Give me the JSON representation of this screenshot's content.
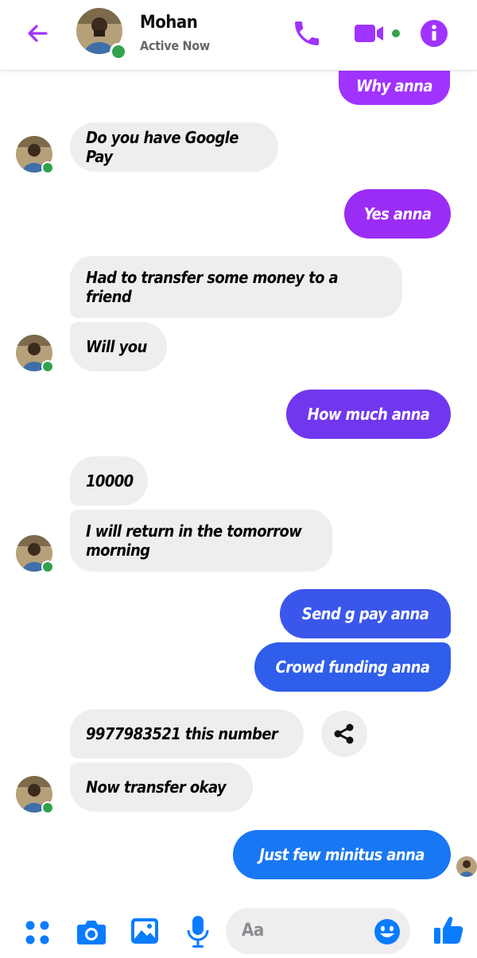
{
  "header": {
    "name": "Mohan",
    "status": "Active Now",
    "accent_color": "#a033ff"
  },
  "messages": [
    {
      "from": "me",
      "text": "Why anna",
      "color": "#a033ff"
    },
    {
      "from": "them",
      "text": "Do you have Google Pay"
    },
    {
      "from": "me",
      "text": "Yes anna",
      "color": "#9b2cf5"
    },
    {
      "from": "them",
      "text": "Had to transfer some money to a friend"
    },
    {
      "from": "them",
      "text": "Will you"
    },
    {
      "from": "me",
      "text": "How much anna",
      "color": "#7137ee"
    },
    {
      "from": "them",
      "text": "10000"
    },
    {
      "from": "them",
      "text": "I will return in the tomorrow morning"
    },
    {
      "from": "me",
      "text": "Send g pay anna",
      "color": "#3b56ea"
    },
    {
      "from": "me",
      "text": "Crowd funding anna",
      "color": "#2e5eea"
    },
    {
      "from": "them",
      "text": "9977983521 this number"
    },
    {
      "from": "them",
      "text": "Now transfer okay"
    },
    {
      "from": "me",
      "text": "Just few minitus anna",
      "color": "#1877f2"
    }
  ],
  "composer": {
    "placeholder": "Aa",
    "icon_color": "#0a7cff"
  },
  "icons": [
    "back-arrow-icon",
    "phone-icon",
    "video-icon",
    "info-icon",
    "share-icon",
    "menu-dots-icon",
    "camera-icon",
    "image-icon",
    "microphone-icon",
    "emoji-icon",
    "thumbs-up-icon"
  ]
}
